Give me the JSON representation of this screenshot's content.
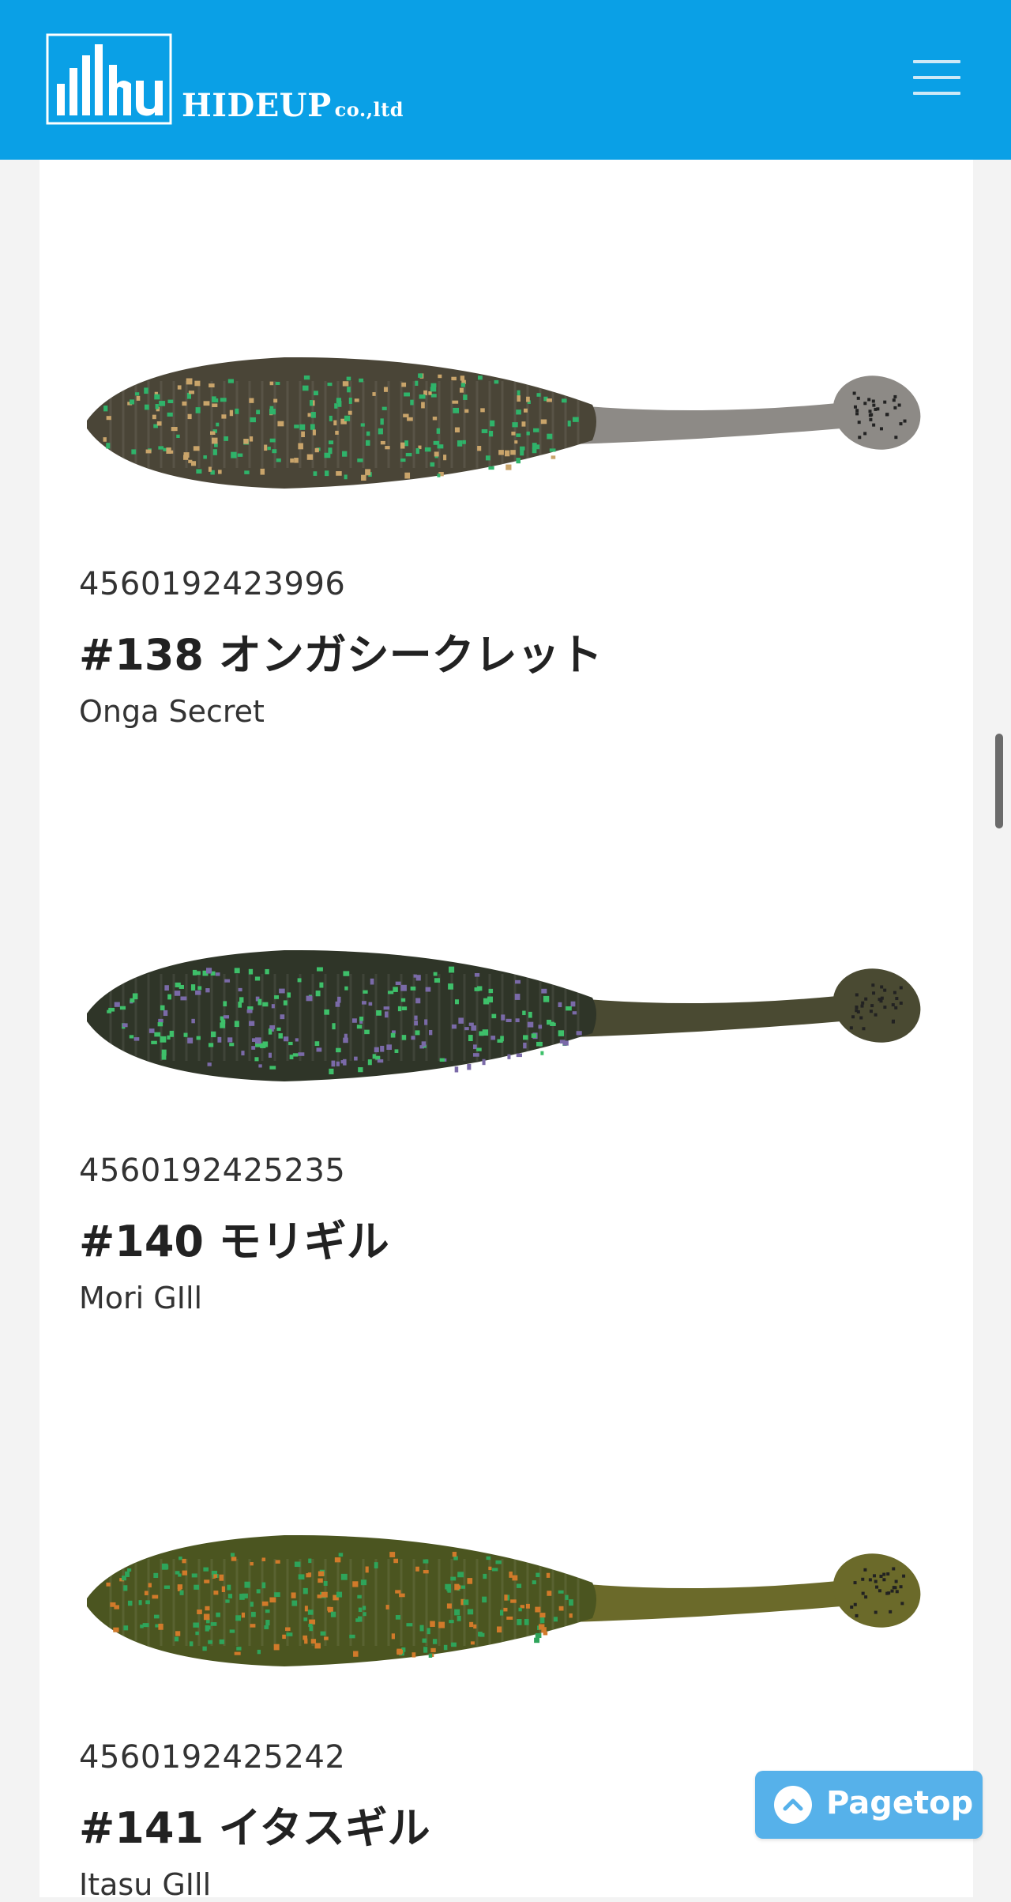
{
  "header": {
    "brand_name": "HIDEUP",
    "brand_suffix": "co.,ltd",
    "logo_mark_text": "hu",
    "menu_icon": "hamburger-menu-icon",
    "background_color": "#0aa0e6"
  },
  "products": [
    {
      "jan": "4560192423996",
      "name": "#138 オンガシークレット",
      "name_en": "Onga Secret",
      "image_icon": "soft-lure-image",
      "colors": {
        "body": "#4a4537",
        "tail": "#8d8a86",
        "flake1": "#2fb36a",
        "flake2": "#c9a46a"
      }
    },
    {
      "jan": "4560192425235",
      "name": "#140 モリギル",
      "name_en": "Mori GIll",
      "image_icon": "soft-lure-image",
      "colors": {
        "body": "#2f3528",
        "tail": "#4a4a32",
        "flake1": "#3ec06a",
        "flake2": "#7a6aa8"
      }
    },
    {
      "jan": "4560192425242",
      "name": "#141 イタスギル",
      "name_en": "Itasu GIll",
      "image_icon": "soft-lure-image",
      "colors": {
        "body": "#4b5520",
        "tail": "#6b6a2a",
        "flake1": "#2ea45a",
        "flake2": "#d17a2a"
      }
    }
  ],
  "pagetop": {
    "label": "Pagetop",
    "icon": "chevron-up-circle-icon",
    "color": "#56b1ea"
  }
}
